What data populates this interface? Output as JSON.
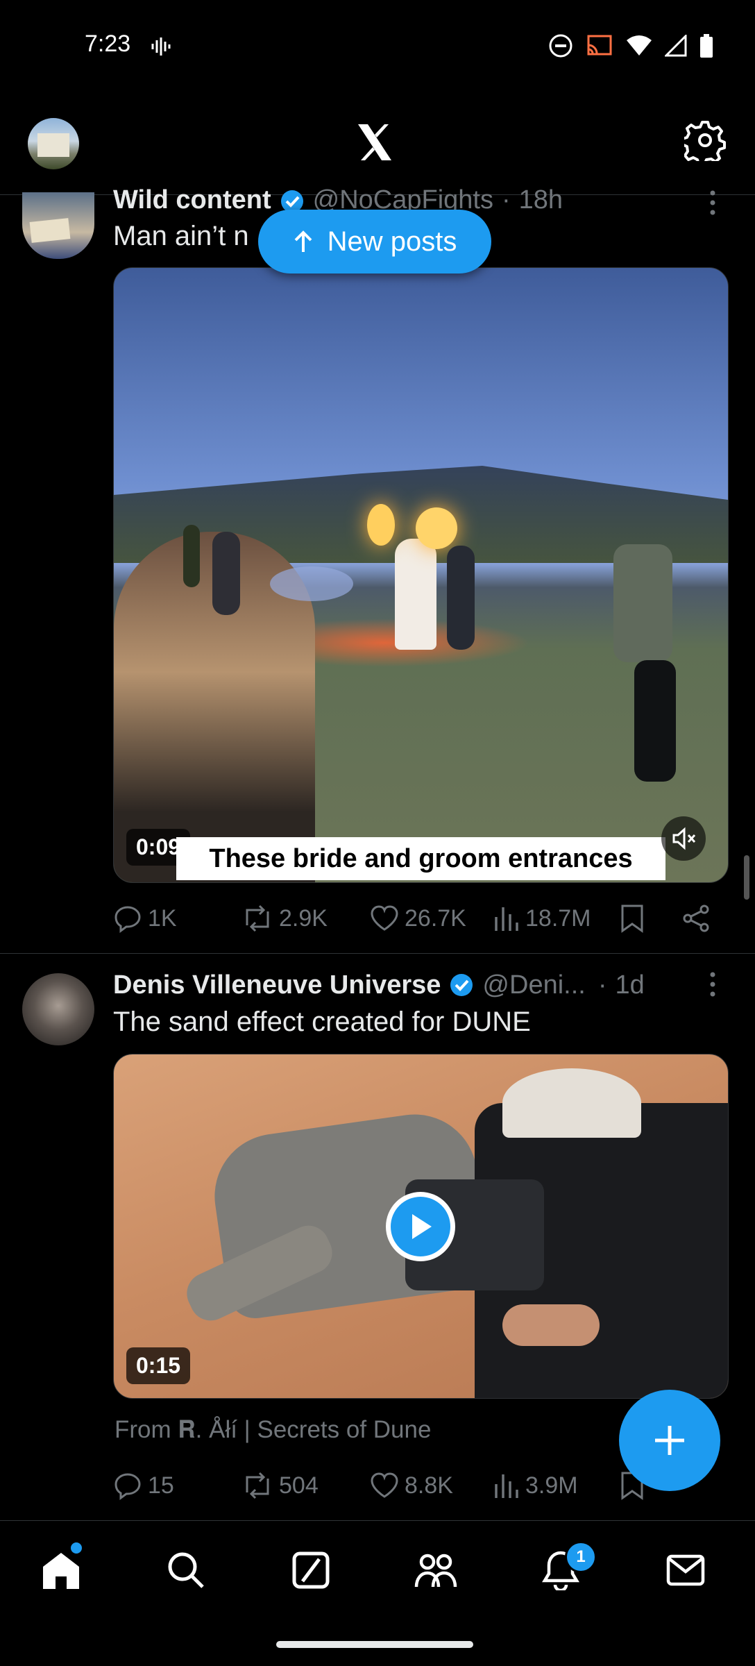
{
  "status_bar": {
    "time": "7:23"
  },
  "new_posts_label": "New posts",
  "tweets": [
    {
      "display_name": "Wild content",
      "handle": "@NoCapFights",
      "age": "18h",
      "text": "Man ain’t n",
      "video_time": "0:09",
      "video_caption": "These bride and groom entrances",
      "replies": "1K",
      "reposts": "2.9K",
      "likes": "26.7K",
      "views": "18.7M"
    },
    {
      "display_name": "Denis Villeneuve Universe",
      "handle": "@Deni...",
      "age": "1d",
      "text": "The sand effect created for DUNE",
      "video_time": "0:15",
      "source": "From 𝐑. Åłí | Secrets of Dune",
      "replies": "15",
      "reposts": "504",
      "likes": "8.8K",
      "views": "3.9M"
    }
  ],
  "nav": {
    "notifications_badge": "1"
  },
  "colors": {
    "accent": "#1d9bf0",
    "background": "#000000",
    "muted": "#71767b"
  }
}
